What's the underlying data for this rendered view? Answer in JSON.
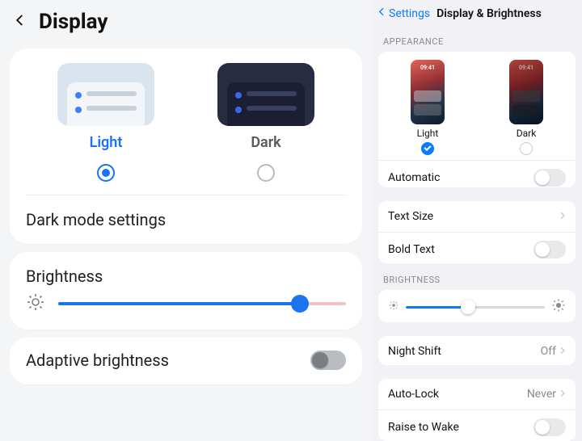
{
  "left": {
    "title": "Display",
    "appearance": {
      "options": [
        {
          "label": "Light",
          "selected": true
        },
        {
          "label": "Dark",
          "selected": false
        }
      ]
    },
    "dark_mode_settings_label": "Dark mode settings",
    "brightness": {
      "label": "Brightness",
      "value_percent": 84
    },
    "adaptive_brightness": {
      "label": "Adaptive brightness",
      "enabled": false
    }
  },
  "right": {
    "nav": {
      "back_label": "Settings",
      "title": "Display & Brightness"
    },
    "appearance": {
      "header": "Appearance",
      "phone_time": "09:41",
      "options": [
        {
          "label": "Light",
          "selected": true
        },
        {
          "label": "Dark",
          "selected": false
        }
      ],
      "automatic": {
        "label": "Automatic",
        "enabled": false
      }
    },
    "text": {
      "text_size_label": "Text Size",
      "bold_text": {
        "label": "Bold Text",
        "enabled": false
      }
    },
    "brightness": {
      "header": "Brightness",
      "value_percent": 45
    },
    "night_shift": {
      "label": "Night Shift",
      "value": "Off"
    },
    "auto_lock": {
      "label": "Auto-Lock",
      "value": "Never"
    },
    "raise_to_wake": {
      "label": "Raise to Wake",
      "enabled": false
    }
  }
}
